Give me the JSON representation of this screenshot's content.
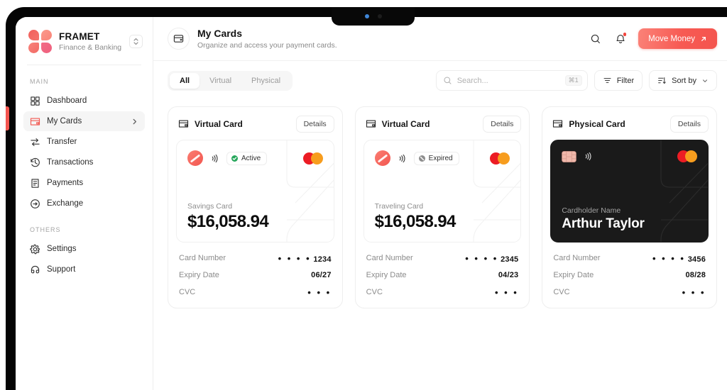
{
  "brand": {
    "name": "FRAMET",
    "tagline": "Finance & Banking",
    "logo_colors": [
      "#f2605c",
      "#fb9a8c",
      "#f8837c",
      "#ef5f7d"
    ],
    "switcher_icon": "chevron-up-down-icon"
  },
  "sidebar": {
    "groups": [
      {
        "label": "MAIN",
        "items": [
          {
            "label": "Dashboard",
            "icon": "grid-icon",
            "active": false,
            "chevron": false
          },
          {
            "label": "My Cards",
            "icon": "credit-card-icon",
            "active": true,
            "chevron": true
          },
          {
            "label": "Transfer",
            "icon": "transfer-icon",
            "active": false,
            "chevron": false
          },
          {
            "label": "Transactions",
            "icon": "history-icon",
            "active": false,
            "chevron": false
          },
          {
            "label": "Payments",
            "icon": "receipt-icon",
            "active": false,
            "chevron": false
          },
          {
            "label": "Exchange",
            "icon": "exchange-icon",
            "active": false,
            "chevron": false
          }
        ]
      },
      {
        "label": "OTHERS",
        "items": [
          {
            "label": "Settings",
            "icon": "gear-icon",
            "active": false,
            "chevron": false
          },
          {
            "label": "Support",
            "icon": "headphones-icon",
            "active": false,
            "chevron": false
          }
        ]
      }
    ]
  },
  "header": {
    "icon": "credit-card-icon",
    "title": "My Cards",
    "subtitle": "Organize and access your payment cards.",
    "search_icon": "search-icon",
    "bell_icon": "bell-icon",
    "has_notification": true,
    "cta": {
      "label": "Move Money",
      "icon": "arrow-up-right-icon",
      "color": "#f4544e"
    }
  },
  "filters": {
    "tabs": [
      {
        "label": "All",
        "active": true
      },
      {
        "label": "Virtual",
        "active": false
      },
      {
        "label": "Physical",
        "active": false
      }
    ],
    "search": {
      "placeholder": "Search...",
      "value": "",
      "shortcut": "⌘1",
      "icon": "search-icon"
    },
    "filter_button": {
      "label": "Filter",
      "icon": "filter-icon"
    },
    "sort_button": {
      "label": "Sort by",
      "icon": "sort-icon",
      "chevron": "chevron-down-icon"
    }
  },
  "cards": [
    {
      "type": "Virtual Card",
      "type_icon": "credit-card-icon",
      "details_label": "Details",
      "theme": "light",
      "chip": "circle-slash-chip",
      "contactless_icon": "contactless-icon",
      "status": {
        "label": "Active",
        "icon": "check-circle-icon",
        "color": "#26a65b"
      },
      "network_logo": "mastercard-logo",
      "name_label": "Savings Card",
      "value": "$16,058.94",
      "rows": [
        {
          "key": "Card Number",
          "value": "1234",
          "masked": true
        },
        {
          "key": "Expiry Date",
          "value": "06/27",
          "masked": false
        },
        {
          "key": "CVC",
          "value": "",
          "masked": true
        }
      ]
    },
    {
      "type": "Virtual Card",
      "type_icon": "credit-card-icon",
      "details_label": "Details",
      "theme": "light",
      "chip": "circle-slash-chip",
      "contactless_icon": "contactless-icon",
      "status": {
        "label": "Expired",
        "icon": "no-entry-circle-icon",
        "color": "#8d8d8d"
      },
      "network_logo": "mastercard-logo",
      "name_label": "Traveling Card",
      "value": "$16,058.94",
      "rows": [
        {
          "key": "Card Number",
          "value": "2345",
          "masked": true
        },
        {
          "key": "Expiry Date",
          "value": "04/23",
          "masked": false
        },
        {
          "key": "CVC",
          "value": "",
          "masked": true
        }
      ]
    },
    {
      "type": "Physical Card",
      "type_icon": "credit-card-icon",
      "details_label": "Details",
      "theme": "dark",
      "chip": "emv-chip",
      "contactless_icon": "contactless-icon",
      "status": null,
      "network_logo": "mastercard-logo",
      "name_label": "Cardholder Name",
      "value": "Arthur Taylor",
      "rows": [
        {
          "key": "Card Number",
          "value": "3456",
          "masked": true
        },
        {
          "key": "Expiry Date",
          "value": "08/28",
          "masked": false
        },
        {
          "key": "CVC",
          "value": "",
          "masked": true
        }
      ]
    }
  ],
  "device": {
    "notch": true,
    "accent_color": "#f4554f"
  }
}
